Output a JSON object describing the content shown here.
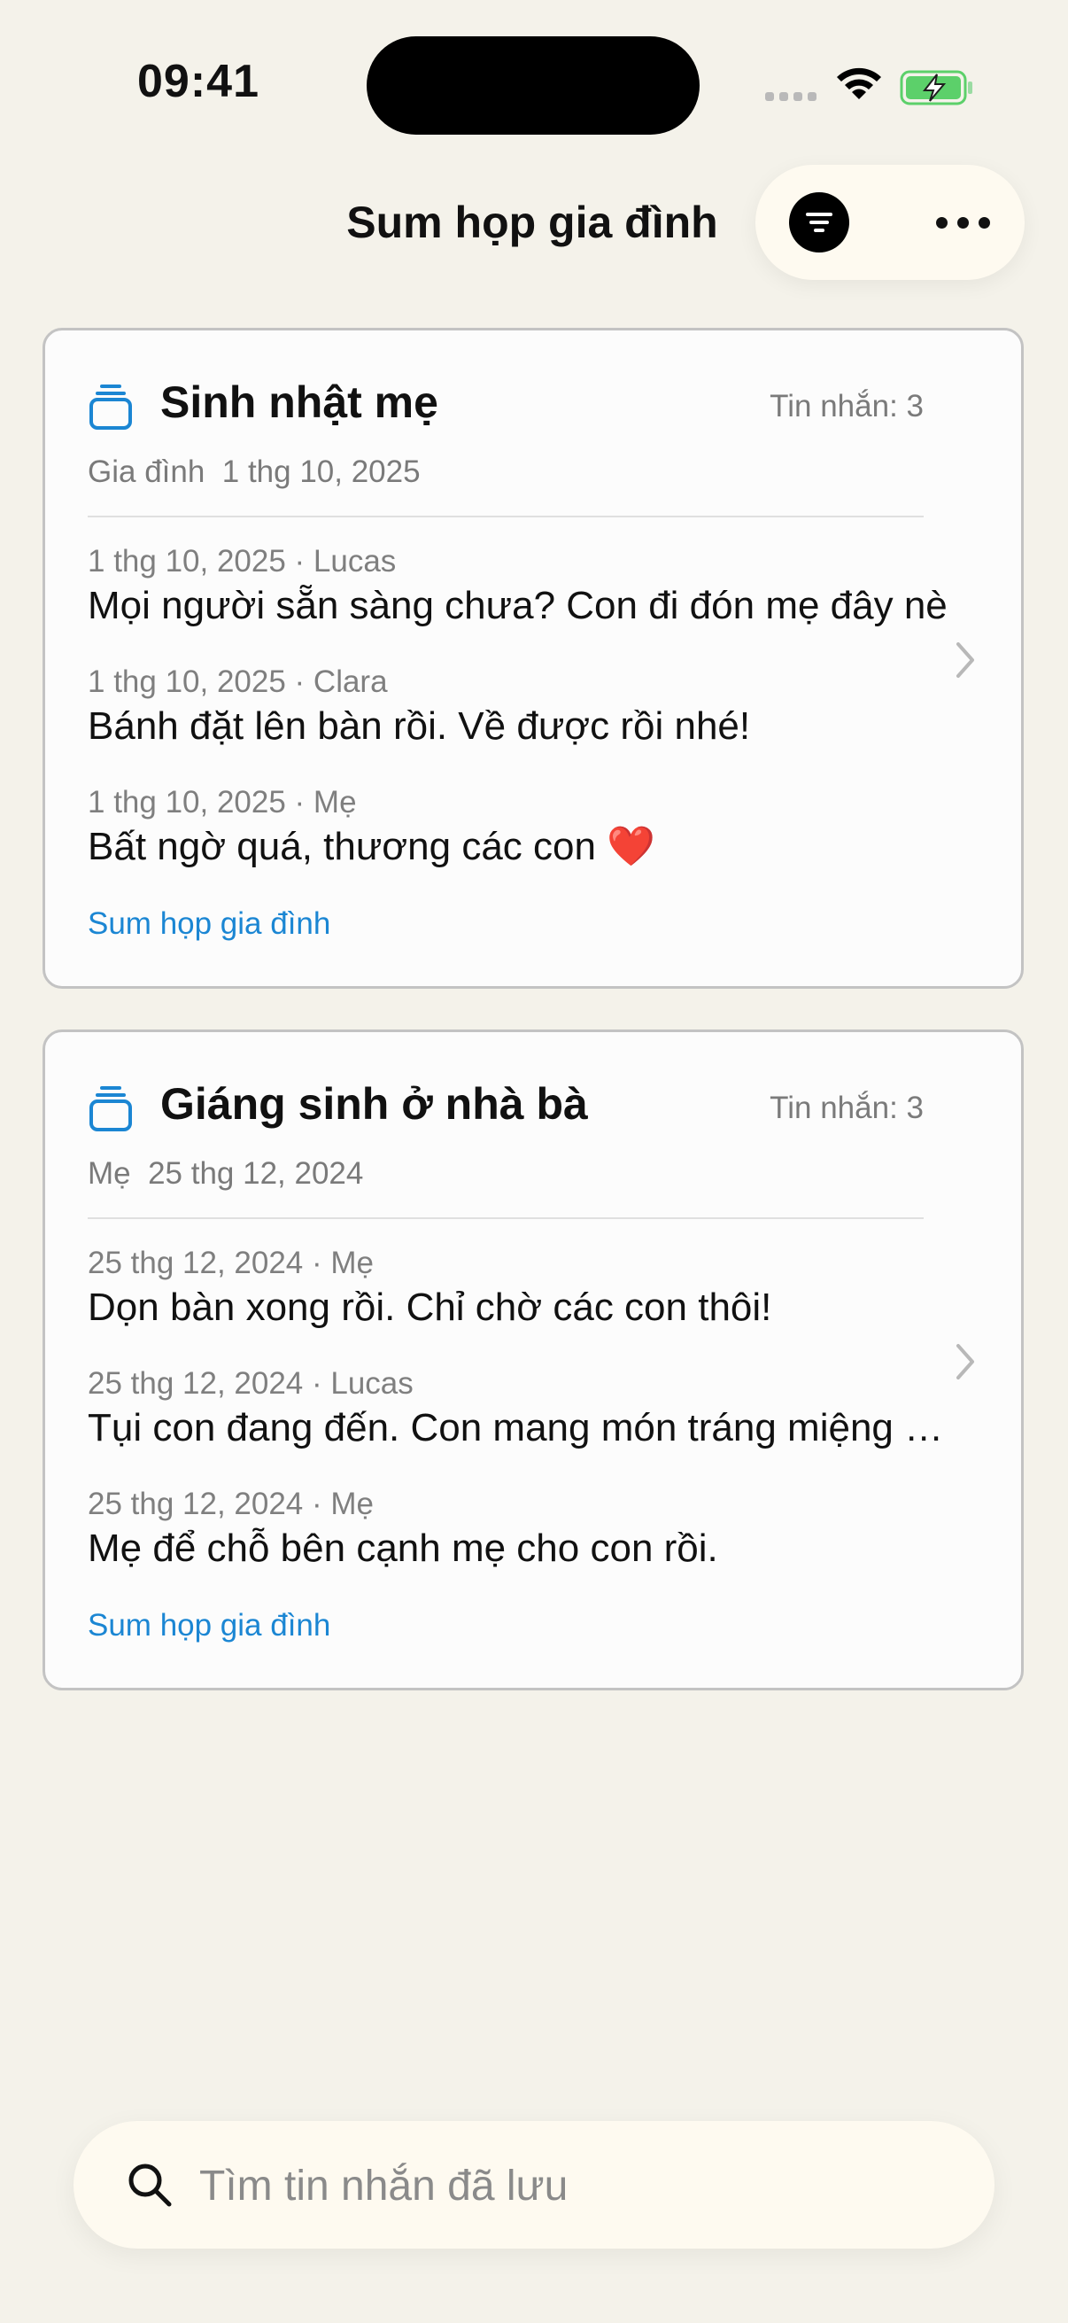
{
  "status_bar": {
    "time": "09:41"
  },
  "header": {
    "title": "Sum họp gia đình"
  },
  "threads": [
    {
      "title": "Sinh nhật mẹ",
      "message_count": "Tin nhắn: 3",
      "meta": "Gia đình  1 thg 10, 2025",
      "messages": [
        {
          "meta": "1 thg 10, 2025 · Lucas",
          "text": "Mọi người sẵn sàng chưa? Con đi đón mẹ đây nè"
        },
        {
          "meta": "1 thg 10, 2025 · Clara",
          "text": "Bánh đặt lên bàn rồi. Về được rồi nhé!"
        },
        {
          "meta": "1 thg 10, 2025 · Mẹ",
          "text": "Bất ngờ quá, thương các con",
          "emoji": "❤️"
        }
      ],
      "group": "Sum họp gia đình"
    },
    {
      "title": "Giáng sinh ở nhà bà",
      "message_count": "Tin nhắn: 3",
      "meta": "Mẹ  25 thg 12, 2024",
      "messages": [
        {
          "meta": "25 thg 12, 2024 · Mẹ",
          "text": "Dọn bàn xong rồi. Chỉ chờ các con thôi!"
        },
        {
          "meta": "25 thg 12, 2024 · Lucas",
          "text": "Tụi con đang đến. Con mang món tráng miệng nhé"
        },
        {
          "meta": "25 thg 12, 2024 · Mẹ",
          "text": "Mẹ để chỗ bên cạnh mẹ cho con rồi."
        }
      ],
      "group": "Sum họp gia đình"
    }
  ],
  "search": {
    "placeholder": "Tìm tin nhắn đã lưu",
    "value": ""
  },
  "colors": {
    "accent": "#1b86d3",
    "background": "#f4f2ea",
    "card": "#fcfcfc"
  }
}
